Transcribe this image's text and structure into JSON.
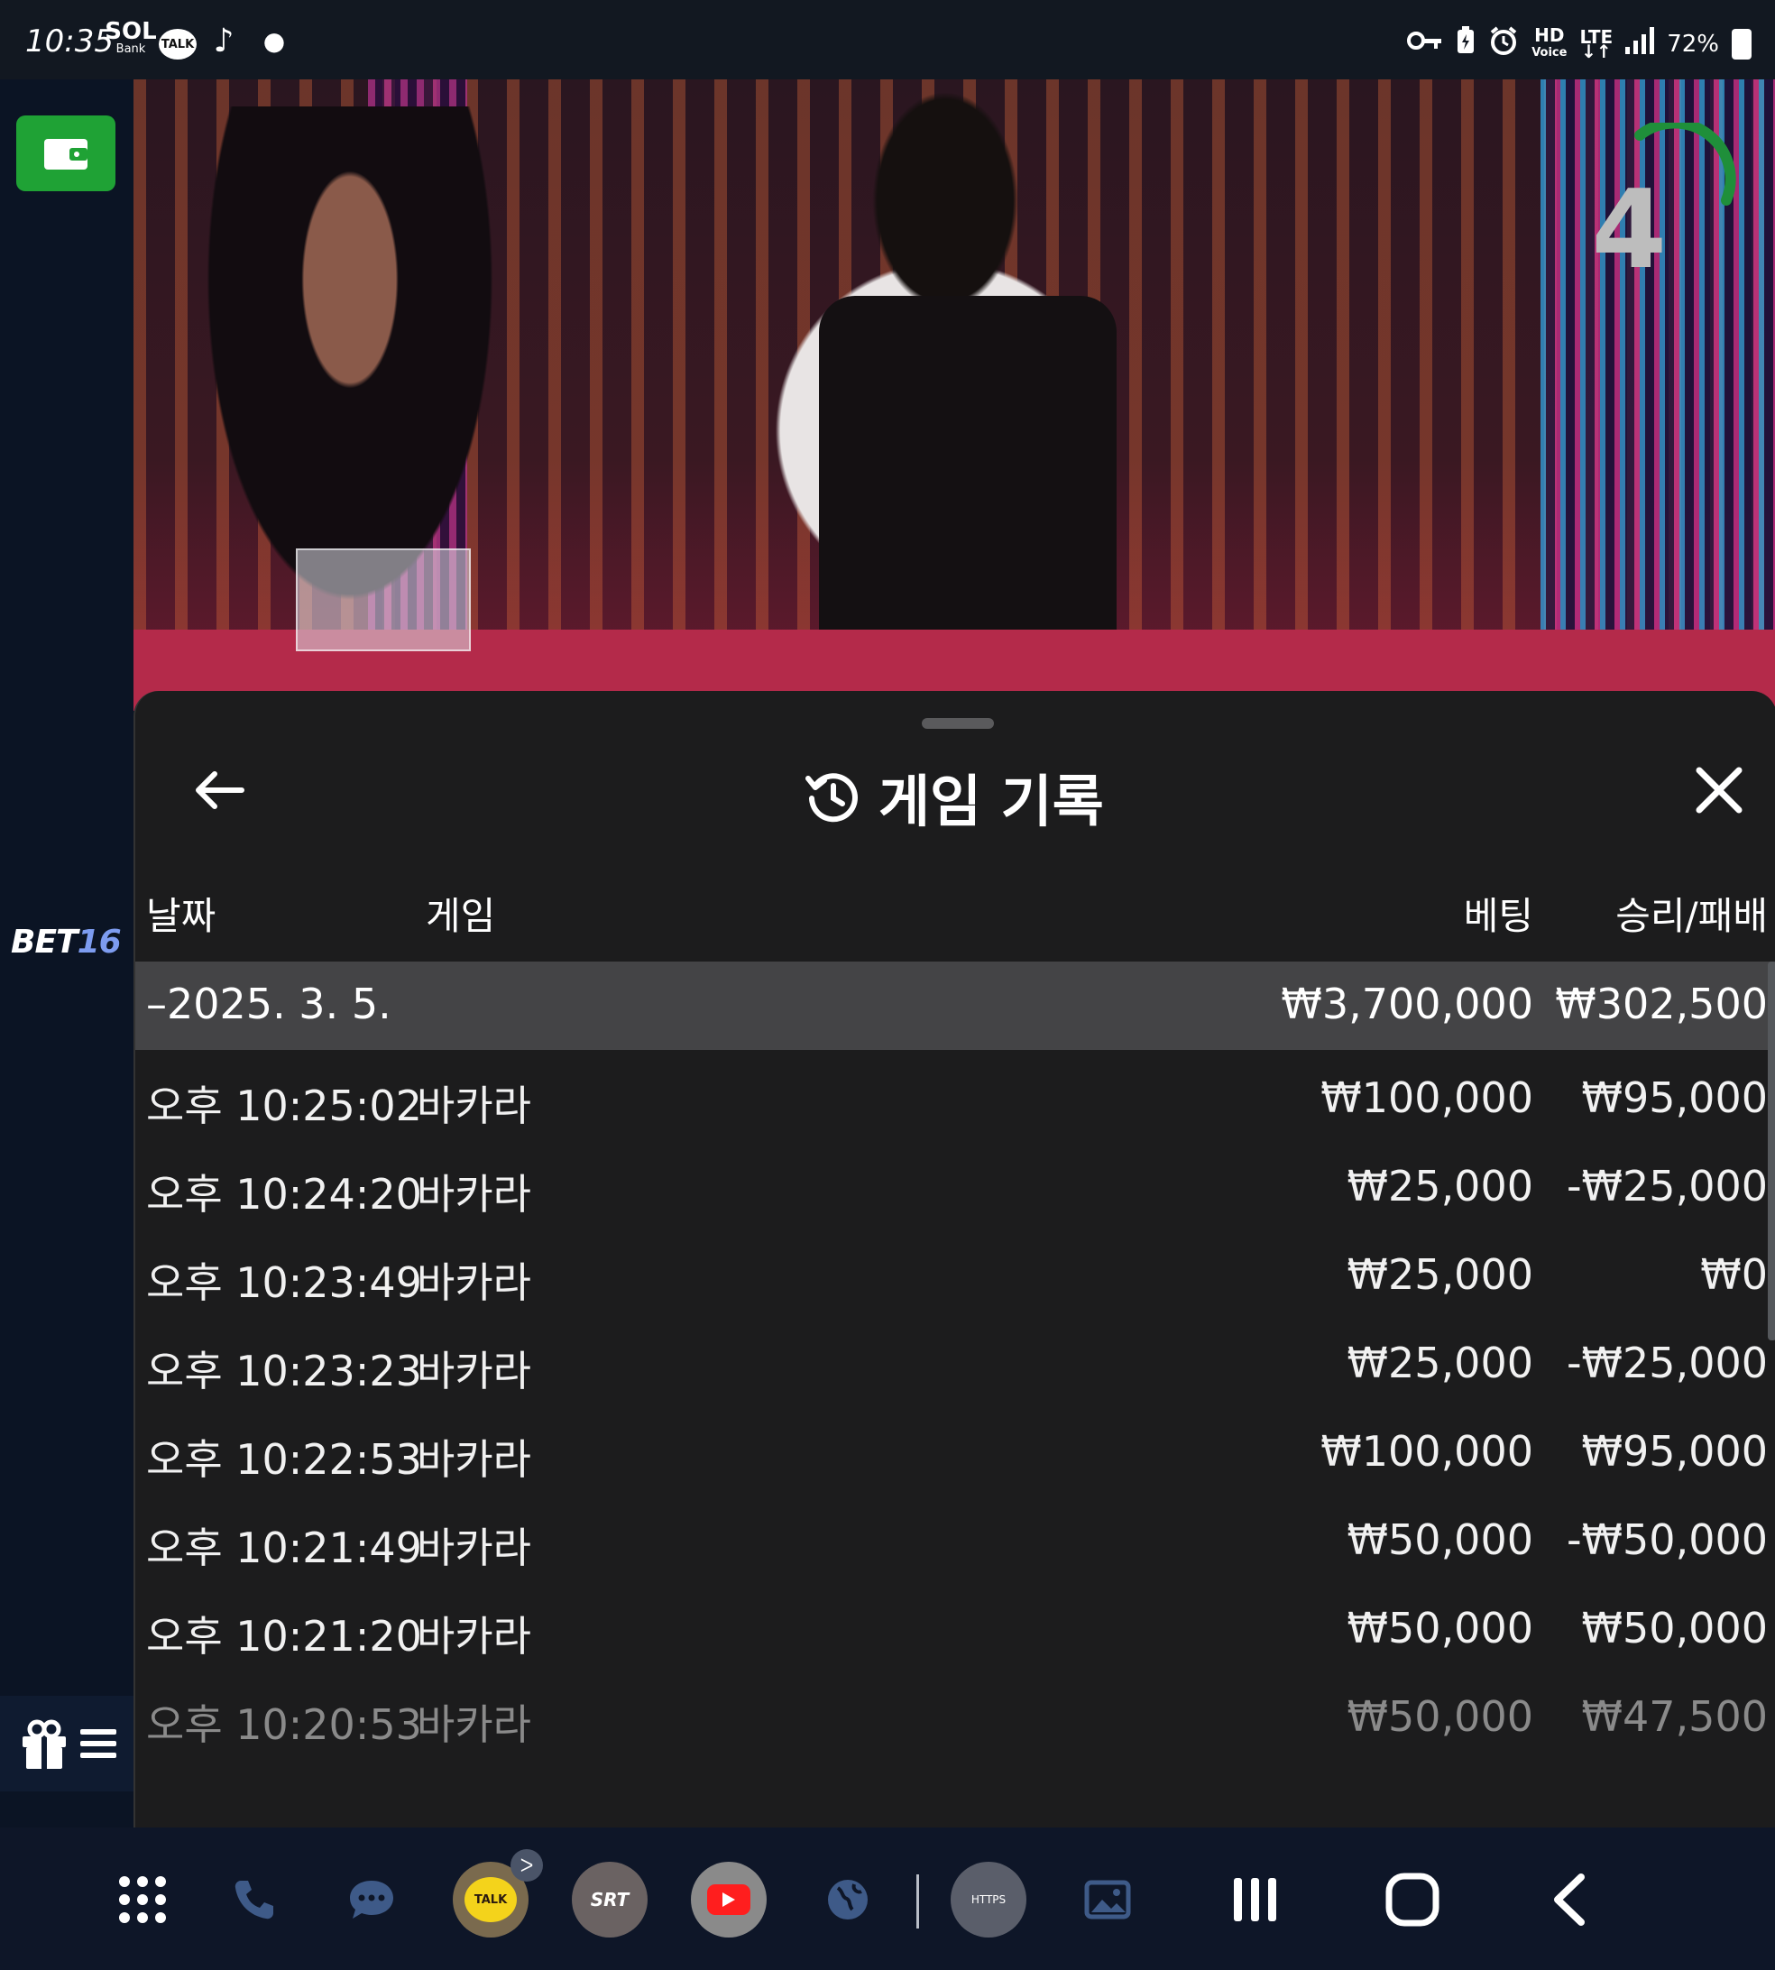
{
  "status_bar": {
    "time": "10:35",
    "apps": [
      "SOL Bank",
      "TALK",
      "TikTok"
    ],
    "sol_label": "SOL",
    "sol_sub": "Bank",
    "talk_label": "TALK",
    "network_hd": "HD",
    "network_voice": "Voice",
    "network_lte": "LTE",
    "battery": "72%"
  },
  "left_rail": {
    "brand_prefix": "BET",
    "brand_number": "16",
    "accent_color": "#1fa235"
  },
  "video": {
    "countdown": "4"
  },
  "history_panel": {
    "title": "게임 기록",
    "columns": {
      "date": "날짜",
      "game": "게임",
      "bet": "베팅",
      "win_loss": "승리/패배"
    },
    "date_group": {
      "date": "–2025. 3. 5.",
      "bet_total": "₩3,700,000",
      "win_total": "₩302,500"
    },
    "rows": [
      {
        "time": "오후 10:25:02",
        "game": "바카라",
        "bet": "₩100,000",
        "result": "₩95,000"
      },
      {
        "time": "오후 10:24:20",
        "game": "바카라",
        "bet": "₩25,000",
        "result": "-₩25,000"
      },
      {
        "time": "오후 10:23:49",
        "game": "바카라",
        "bet": "₩25,000",
        "result": "₩0"
      },
      {
        "time": "오후 10:23:23",
        "game": "바카라",
        "bet": "₩25,000",
        "result": "-₩25,000"
      },
      {
        "time": "오후 10:22:53",
        "game": "바카라",
        "bet": "₩100,000",
        "result": "₩95,000"
      },
      {
        "time": "오후 10:21:49",
        "game": "바카라",
        "bet": "₩50,000",
        "result": "-₩50,000"
      },
      {
        "time": "오후 10:21:20",
        "game": "바카라",
        "bet": "₩50,000",
        "result": "₩50,000"
      },
      {
        "time": "오후 10:20:53",
        "game": "바카라",
        "bet": "₩50,000",
        "result": "₩47,500"
      }
    ]
  },
  "nav_bar": {
    "kakao_label": "TALK",
    "kakao_badge": "ᐳ",
    "srt_label": "SRT",
    "https_label": "HTTPS"
  }
}
